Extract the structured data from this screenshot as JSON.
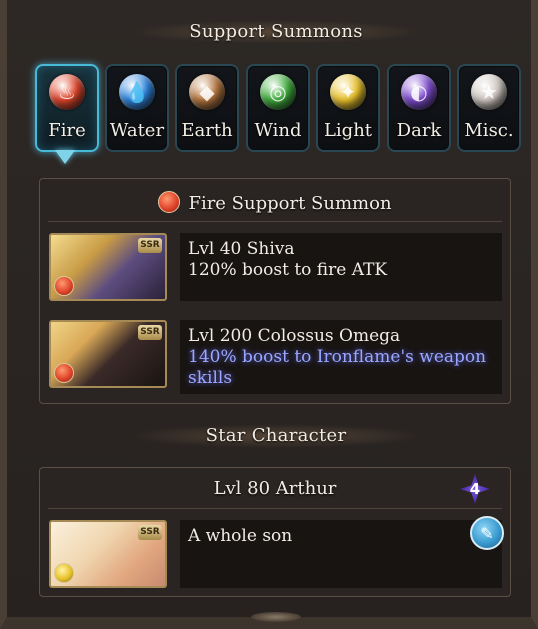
{
  "support_summons": {
    "title": "Support Summons",
    "tabs": [
      {
        "label": "Fire",
        "icon": "fire-icon",
        "color": "#e0452a",
        "glyph": "♨",
        "active": true
      },
      {
        "label": "Water",
        "icon": "water-icon",
        "color": "#2f86e0",
        "glyph": "💧",
        "active": false
      },
      {
        "label": "Earth",
        "icon": "earth-icon",
        "color": "#b5763e",
        "glyph": "◆",
        "active": false
      },
      {
        "label": "Wind",
        "icon": "wind-icon",
        "color": "#3fae3c",
        "glyph": "◎",
        "active": false
      },
      {
        "label": "Light",
        "icon": "light-icon",
        "color": "#e9c22a",
        "glyph": "✦",
        "active": false
      },
      {
        "label": "Dark",
        "icon": "dark-icon",
        "color": "#7e4bd0",
        "glyph": "◐",
        "active": false
      },
      {
        "label": "Misc.",
        "icon": "star-icon",
        "color": "#cfc7c0",
        "glyph": "★",
        "active": false
      }
    ]
  },
  "fire_box": {
    "header": "Fire Support Summon",
    "header_icon": "fire-icon",
    "entries": [
      {
        "rarity": "SSR",
        "line1": "Lvl 40 Shiva",
        "line2": "120% boost to fire ATK",
        "highlight": false,
        "element_icon": "fire-icon",
        "art_colors": [
          "#e8c46a",
          "#6a5a8a"
        ]
      },
      {
        "rarity": "SSR",
        "line1": "Lvl 200 Colossus Omega",
        "line2": "140% boost to Ironflame's weapon skills",
        "highlight": true,
        "element_icon": "fire-icon",
        "art_colors": [
          "#e7c26a",
          "#3a2a28"
        ]
      }
    ]
  },
  "star_character": {
    "title": "Star Character",
    "name": "Lvl 80 Arthur",
    "star_count": "4",
    "rarity": "SSR",
    "comment": "A whole son",
    "element_icon": "light-icon",
    "art_colors": [
      "#f4e6c8",
      "#e2b08a"
    ],
    "edit_icon": "pencil-icon"
  }
}
